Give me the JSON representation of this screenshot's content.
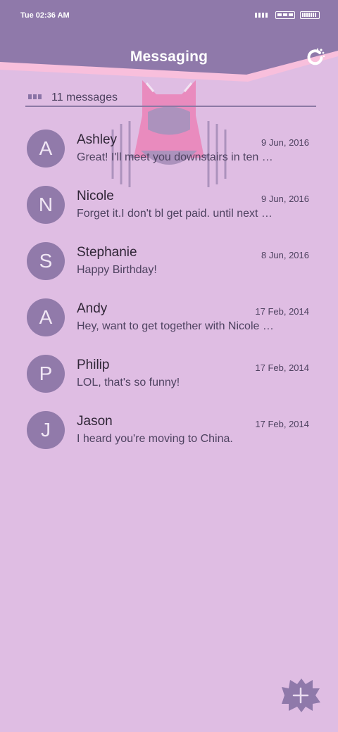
{
  "status": {
    "time": "Tue 02:36 AM"
  },
  "header": {
    "title": "Messaging",
    "refresh_icon": "refresh-icon",
    "colors": {
      "header": "#8f79aa",
      "accent_stripe": "#f8bfdc",
      "background": "#dfbde3"
    }
  },
  "summary": {
    "count_text": "11 messages",
    "icon": "list-icon"
  },
  "conversations": [
    {
      "initial": "A",
      "name": "Ashley",
      "date": "9 Jun, 2016",
      "preview": "Great! I'll meet you downstairs in ten …"
    },
    {
      "initial": "N",
      "name": "Nicole",
      "date": "9 Jun, 2016",
      "preview": "Forget it.I don't bl get paid. until next …"
    },
    {
      "initial": "S",
      "name": "Stephanie",
      "date": "8 Jun, 2016",
      "preview": "Happy Birthday!"
    },
    {
      "initial": "A",
      "name": "Andy",
      "date": "17 Feb, 2014",
      "preview": "Hey, want to get together with Nicole …"
    },
    {
      "initial": "P",
      "name": "Philip",
      "date": "17 Feb, 2014",
      "preview": "LOL, that's so funny!"
    },
    {
      "initial": "J",
      "name": "Jason",
      "date": "17 Feb, 2014",
      "preview": "I heard you're moving to China."
    }
  ],
  "fab": {
    "icon": "plus-icon"
  }
}
